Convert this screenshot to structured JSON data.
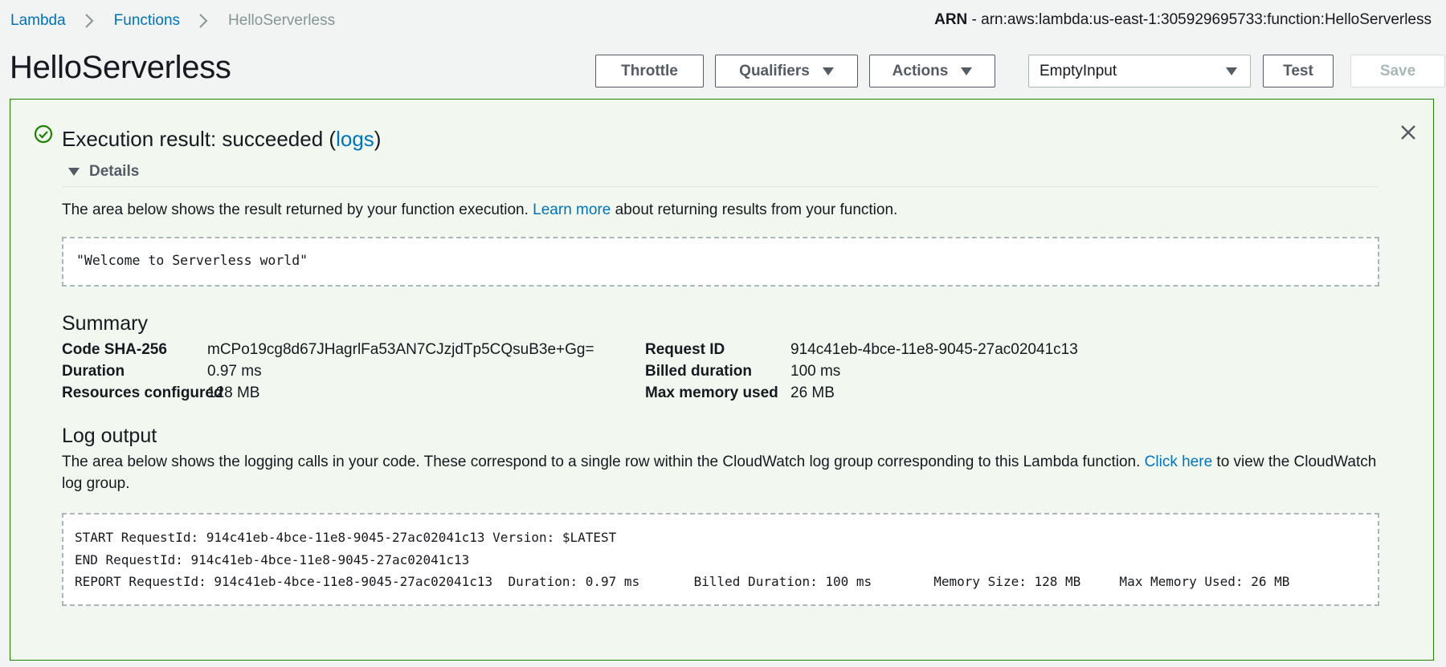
{
  "breadcrumb": {
    "items": [
      {
        "label": "Lambda"
      },
      {
        "label": "Functions"
      },
      {
        "label": "HelloServerless"
      }
    ]
  },
  "arn": {
    "label": "ARN",
    "value": " - arn:aws:lambda:us-east-1:305929695733:function:HelloServerless"
  },
  "page_title": "HelloServerless",
  "toolbar": {
    "throttle_label": "Throttle",
    "qualifiers_label": "Qualifiers",
    "actions_label": "Actions",
    "test_event_selected": "EmptyInput",
    "test_label": "Test",
    "save_label": "Save"
  },
  "result": {
    "title_prefix": "Execution result: succeeded (",
    "logs_link": "logs",
    "title_suffix": ")",
    "details_label": "Details",
    "description_before": "The area below shows the result returned by your function execution. ",
    "learn_more_link": "Learn more",
    "description_after": " about returning results from your function.",
    "output": "\"Welcome to Serverless world\""
  },
  "summary": {
    "heading": "Summary",
    "left": [
      {
        "label": "Code SHA-256",
        "value": "mCPo19cg8d67JHagrlFa53AN7CJzjdTp5CQsuB3e+Gg="
      },
      {
        "label": "Duration",
        "value": "0.97 ms"
      },
      {
        "label": "Resources configured",
        "value": "128 MB"
      }
    ],
    "right": [
      {
        "label": "Request ID",
        "value": "914c41eb-4bce-11e8-9045-27ac02041c13"
      },
      {
        "label": "Billed duration",
        "value": "100 ms"
      },
      {
        "label": "Max memory used",
        "value": "26 MB"
      }
    ]
  },
  "log_output": {
    "heading": "Log output",
    "description_before": "The area below shows the logging calls in your code. These correspond to a single row within the CloudWatch log group corresponding to this Lambda function. ",
    "click_here_link": "Click here",
    "description_after": " to view the CloudWatch log group.",
    "lines": [
      "START RequestId: 914c41eb-4bce-11e8-9045-27ac02041c13 Version: $LATEST",
      "END RequestId: 914c41eb-4bce-11e8-9045-27ac02041c13",
      "REPORT RequestId: 914c41eb-4bce-11e8-9045-27ac02041c13  Duration: 0.97 ms       Billed Duration: 100 ms        Memory Size: 128 MB     Max Memory Used: 26 MB"
    ]
  },
  "colors": {
    "link": "#0073bb",
    "success": "#1d8102",
    "panel_background": "#f2f8f0",
    "page_background": "#f2f3f3"
  },
  "icons": {
    "breadcrumb_separator": "chevron-right-icon",
    "status": "check-circle-icon",
    "close": "close-icon",
    "dropdown": "caret-down-icon"
  }
}
